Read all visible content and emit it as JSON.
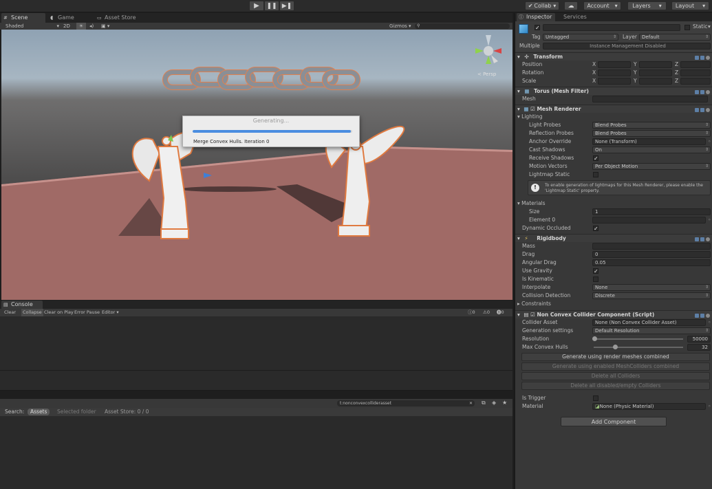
{
  "toolbar": {
    "collab": "Collab",
    "account": "Account",
    "layers": "Layers",
    "layout": "Layout"
  },
  "scene_tabs": {
    "scene": "Scene",
    "game": "Game",
    "asset_store": "Asset Store"
  },
  "scene_toolbar": {
    "shading": "Shaded",
    "mode_2d": "2D",
    "gizmos": "Gizmos"
  },
  "viewport": {
    "persp": "< Persp",
    "progress_title": "Generating...",
    "progress_message": "Merge Convex Hulls. Iteration 0",
    "progress": 0.99
  },
  "console": {
    "tab": "Console",
    "buttons": [
      "Clear",
      "Collapse",
      "Clear on Play",
      "Error Pause",
      "Editor"
    ],
    "count_info": "0",
    "count_warn": "0",
    "count_err": "0"
  },
  "project": {
    "search_value": "t:nonconvexcolliderasset",
    "search_label": "Search:",
    "scope_assets": "Assets",
    "scope_selected": "Selected folder",
    "scope_store": "Asset Store: 0 / 0"
  },
  "inspector": {
    "tab_inspector": "Inspector",
    "tab_services": "Services",
    "static": "Static",
    "tag_label": "Tag",
    "tag_value": "Untagged",
    "layer_label": "Layer",
    "layer_value": "Default",
    "multiple_label": "Multiple",
    "multiple_note": "Instance Management Disabled",
    "transform": {
      "title": "Transform",
      "rows": [
        {
          "label": "Position",
          "x": "X",
          "y": "Y",
          "z": "Z"
        },
        {
          "label": "Rotation",
          "x": "X",
          "y": "Y",
          "z": "Z"
        },
        {
          "label": "Scale",
          "x": "X",
          "y": "Y",
          "z": "Z"
        }
      ]
    },
    "mesh_filter": {
      "title": "Torus (Mesh Filter)",
      "mesh_label": "Mesh"
    },
    "mesh_renderer": {
      "title": "Mesh Renderer",
      "lighting": "Lighting",
      "light_probes_label": "Light Probes",
      "light_probes_value": "Blend Probes",
      "reflection_probes_label": "Reflection Probes",
      "reflection_probes_value": "Blend Probes",
      "anchor_override_label": "Anchor Override",
      "anchor_override_value": "None (Transform)",
      "cast_shadows_label": "Cast Shadows",
      "cast_shadows_value": "On",
      "receive_shadows_label": "Receive Shadows",
      "motion_vectors_label": "Motion Vectors",
      "motion_vectors_value": "Per Object Motion",
      "lightmap_static_label": "Lightmap Static",
      "info": "To enable generation of lightmaps for this Mesh Renderer, please enable the 'Lightmap Static' property.",
      "materials": "Materials",
      "size_label": "Size",
      "size_value": "1",
      "element0_label": "Element 0",
      "dynamic_occluded_label": "Dynamic Occluded"
    },
    "rigidbody": {
      "title": "Rigidbody",
      "mass_label": "Mass",
      "drag_label": "Drag",
      "drag_value": "0",
      "angular_drag_label": "Angular Drag",
      "angular_drag_value": "0.05",
      "use_gravity_label": "Use Gravity",
      "is_kinematic_label": "Is Kinematic",
      "interpolate_label": "Interpolate",
      "interpolate_value": "None",
      "collision_detection_label": "Collision Detection",
      "collision_detection_value": "Discrete",
      "constraints_label": "Constraints"
    },
    "non_convex": {
      "title": "Non Convex Collider Component (Script)",
      "collider_asset_label": "Collider Asset",
      "collider_asset_value": "None (Non Convex Collider Asset)",
      "generation_settings_label": "Generation settings",
      "generation_settings_value": "Default Resolution",
      "resolution_label": "Resolution",
      "resolution_value": "50000",
      "max_hulls_label": "Max Convex Hulls",
      "max_hulls_value": "32",
      "btn_render_meshes": "Generate using render meshes combined",
      "btn_mesh_colliders": "Generate using enabled MeshColliders combined",
      "btn_delete_all": "Delete all Colliders",
      "btn_delete_disabled": "Delete all disabled/empty Colliders",
      "is_trigger_label": "Is Trigger",
      "material_label": "Material",
      "material_value": "None (Physic Material)"
    },
    "add_component": "Add Component"
  }
}
